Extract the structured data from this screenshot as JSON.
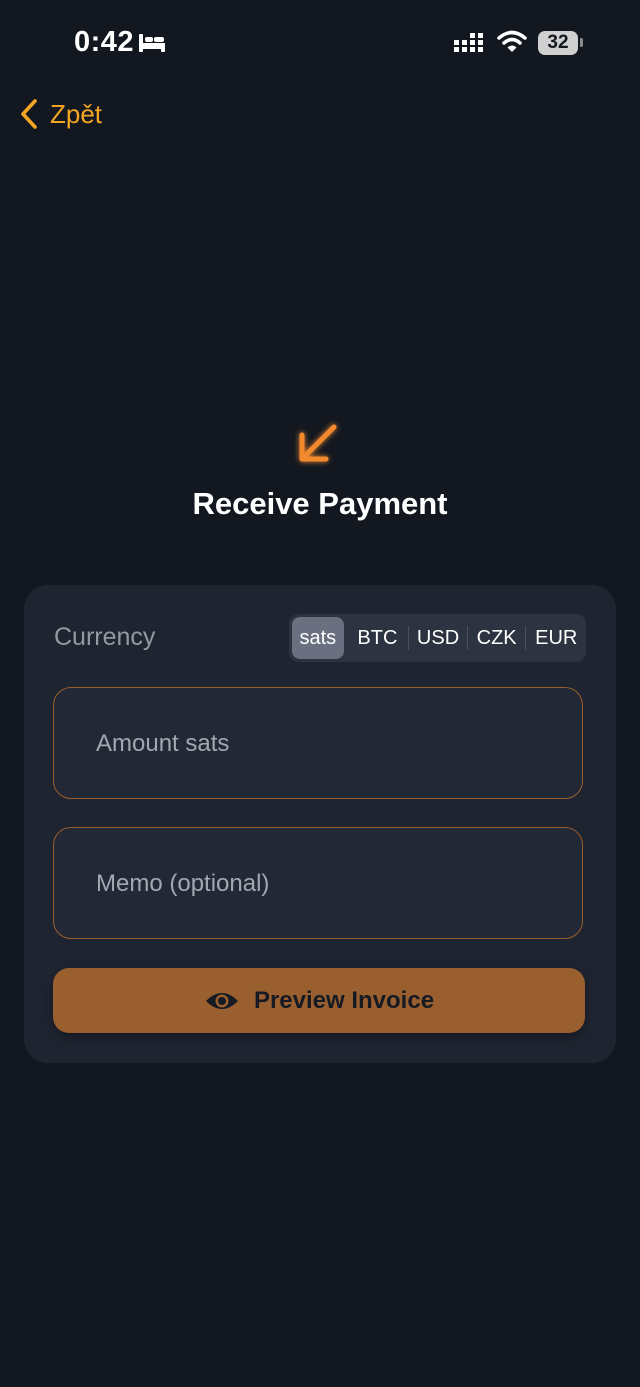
{
  "status_bar": {
    "time": "0:42",
    "battery": "32"
  },
  "nav": {
    "back_label": "Zpět"
  },
  "header": {
    "title": "Receive Payment"
  },
  "form": {
    "currency_label": "Currency",
    "currency_options": [
      "sats",
      "BTC",
      "USD",
      "CZK",
      "EUR"
    ],
    "selected_currency": "sats",
    "amount_placeholder": "Amount sats",
    "memo_placeholder": "Memo (optional)",
    "preview_button_label": "Preview Invoice"
  },
  "colors": {
    "background": "#121720",
    "card": "#1f2431",
    "accent": "#f5a524",
    "button": "#9a5f2f",
    "field_border": "#9a5f2b"
  },
  "icons": {
    "back": "chevron-left-icon",
    "receive": "arrow-down-left-icon",
    "preview": "eye-icon",
    "sleep": "bed-icon",
    "signal": "cellular-signal-icon",
    "wifi": "wifi-icon"
  }
}
